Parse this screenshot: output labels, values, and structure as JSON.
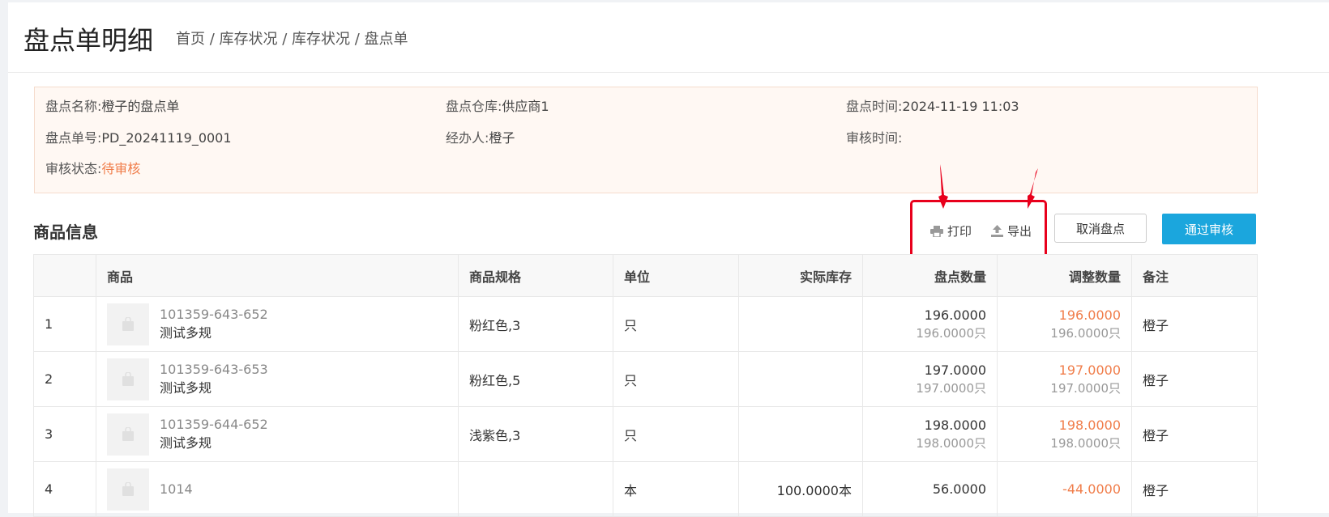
{
  "header": {
    "title": "盘点单明细",
    "breadcrumb": "首页 / 库存状况 / 库存状况 / 盘点单"
  },
  "info": {
    "name_label": "盘点名称:",
    "name_value": "橙子的盘点单",
    "warehouse_label": "盘点仓库:",
    "warehouse_value": "供应商1",
    "time_label": "盘点时间:",
    "time_value": "2024-11-19 11:03",
    "number_label": "盘点单号:",
    "number_value": "PD_20241119_0001",
    "handler_label": "经办人:",
    "handler_value": "橙子",
    "audit_time_label": "审核时间:",
    "audit_time_value": "",
    "status_label": "审核状态:",
    "status_value": "待审核",
    "status_color": "#f07d4a"
  },
  "section": {
    "title": "商品信息",
    "print_label": "打印",
    "print_icon": "printer-icon",
    "export_label": "导出",
    "export_icon": "upload-icon",
    "cancel_label": "取消盘点",
    "approve_label": "通过审核",
    "approve_color": "#1ba6dd",
    "annotation_color": "#e8001c"
  },
  "table": {
    "columns": [
      "",
      "商品",
      "商品规格",
      "单位",
      "实际库存",
      "盘点数量",
      "调整数量",
      "备注"
    ],
    "rows": [
      {
        "index": "1",
        "code": "101359-643-652",
        "name": "测试多规",
        "spec": "粉红色,3",
        "unit": "只",
        "actual": "",
        "count": "196.0000",
        "count_sub": "196.0000只",
        "adjust": "196.0000",
        "adjust_sub": "196.0000只",
        "remark": "橙子"
      },
      {
        "index": "2",
        "code": "101359-643-653",
        "name": "测试多规",
        "spec": "粉红色,5",
        "unit": "只",
        "actual": "",
        "count": "197.0000",
        "count_sub": "197.0000只",
        "adjust": "197.0000",
        "adjust_sub": "197.0000只",
        "remark": "橙子"
      },
      {
        "index": "3",
        "code": "101359-644-652",
        "name": "测试多规",
        "spec": "浅紫色,3",
        "unit": "只",
        "actual": "",
        "count": "198.0000",
        "count_sub": "198.0000只",
        "adjust": "198.0000",
        "adjust_sub": "198.0000只",
        "remark": "橙子"
      },
      {
        "index": "4",
        "code": "1014",
        "name": "",
        "spec": "",
        "unit": "本",
        "actual": "100.0000本",
        "count": "56.0000",
        "count_sub": "",
        "adjust": "-44.0000",
        "adjust_sub": "",
        "remark": "橙子"
      }
    ]
  }
}
